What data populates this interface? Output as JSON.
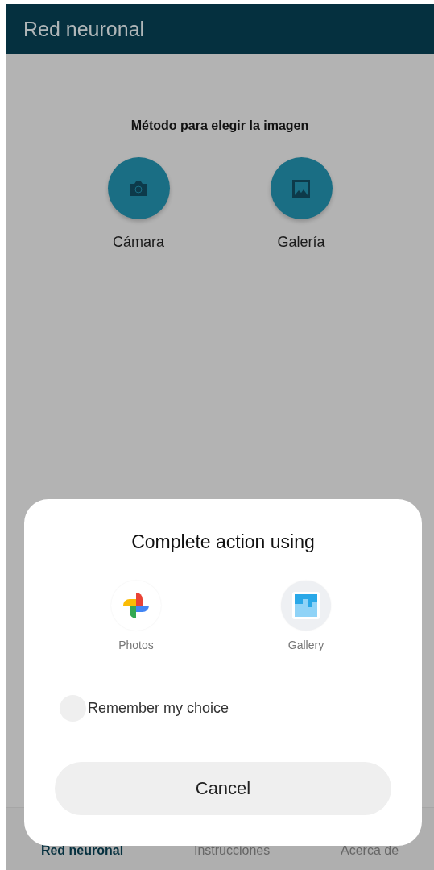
{
  "app_bar": {
    "title": "Red neuronal"
  },
  "content": {
    "heading": "Método para elegir la imagen",
    "options": [
      {
        "kind": "camera",
        "label": "Cámara"
      },
      {
        "kind": "gallery",
        "label": "Galería"
      }
    ]
  },
  "bottom_nav": [
    {
      "label": "Red neuronal",
      "selected": true
    },
    {
      "label": "Instrucciones",
      "selected": false
    },
    {
      "label": "Acerca de",
      "selected": false
    }
  ],
  "dialog": {
    "title": "Complete action using",
    "apps": [
      {
        "kind": "photos",
        "label": "Photos"
      },
      {
        "kind": "gallery",
        "label": "Gallery"
      }
    ],
    "remember": {
      "label": "Remember my choice",
      "checked": false
    },
    "button": "Cancel"
  }
}
